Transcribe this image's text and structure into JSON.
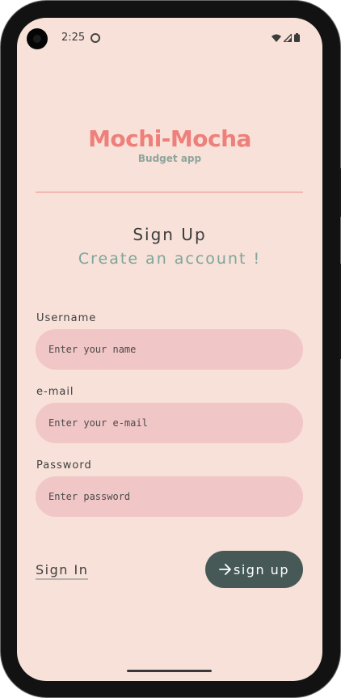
{
  "status_bar": {
    "time": "2:25"
  },
  "brand": {
    "name": "Mochi-Mocha",
    "subtitle": "Budget app"
  },
  "form": {
    "title": "Sign Up",
    "subtitle": "Create an account !",
    "username": {
      "label": "Username",
      "placeholder": "Enter your name",
      "value": ""
    },
    "email": {
      "label": "e-mail",
      "placeholder": "Enter your e-mail",
      "value": ""
    },
    "password": {
      "label": "Password",
      "placeholder": "Enter password",
      "value": ""
    }
  },
  "actions": {
    "sign_in_label": "Sign In",
    "sign_up_label": "sign up",
    "sign_up_icon": "arrow-right-icon"
  },
  "colors": {
    "background": "#f7e1d8",
    "brand": "#ee7f7a",
    "field": "#f1c6c6",
    "accent_text": "#7ea59c",
    "button": "#475957"
  }
}
